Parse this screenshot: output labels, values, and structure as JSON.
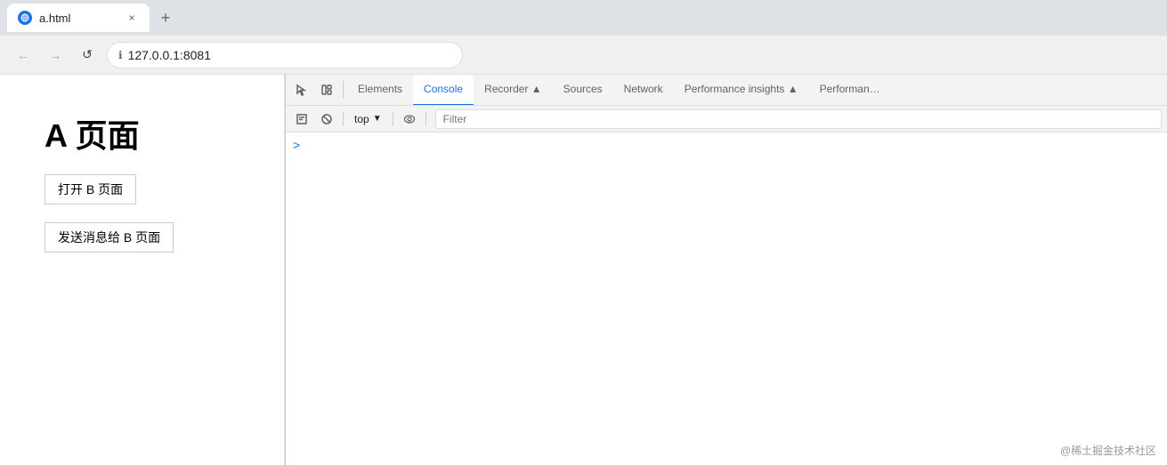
{
  "browser": {
    "tab": {
      "title": "a.html",
      "close_label": "×",
      "new_tab_label": "+"
    },
    "address": {
      "url": "127.0.0.1:8081"
    },
    "nav": {
      "back": "←",
      "forward": "→",
      "reload": "↺"
    }
  },
  "page": {
    "title": "A 页面",
    "button1_label": "打开 B 页面",
    "button2_label": "发送消息给 B 页面"
  },
  "devtools": {
    "tabs": [
      {
        "id": "elements",
        "label": "Elements",
        "active": false
      },
      {
        "id": "console",
        "label": "Console",
        "active": true
      },
      {
        "id": "recorder",
        "label": "Recorder ▲",
        "active": false
      },
      {
        "id": "sources",
        "label": "Sources",
        "active": false
      },
      {
        "id": "network",
        "label": "Network",
        "active": false
      },
      {
        "id": "performance-insights",
        "label": "Performance insights ▲",
        "active": false
      },
      {
        "id": "performance",
        "label": "Performan…",
        "active": false
      }
    ],
    "toolbar": {
      "context_label": "top",
      "filter_placeholder": "Filter"
    },
    "console_prompt": ">"
  },
  "watermark": {
    "text": "@稀土掘金技术社区"
  },
  "icons": {
    "cursor_icon": "⬚",
    "layout_icon": "⬜",
    "inspect_icon": "⬚",
    "block_icon": "⊘",
    "eye_icon": "👁",
    "chevron_right": "›"
  }
}
